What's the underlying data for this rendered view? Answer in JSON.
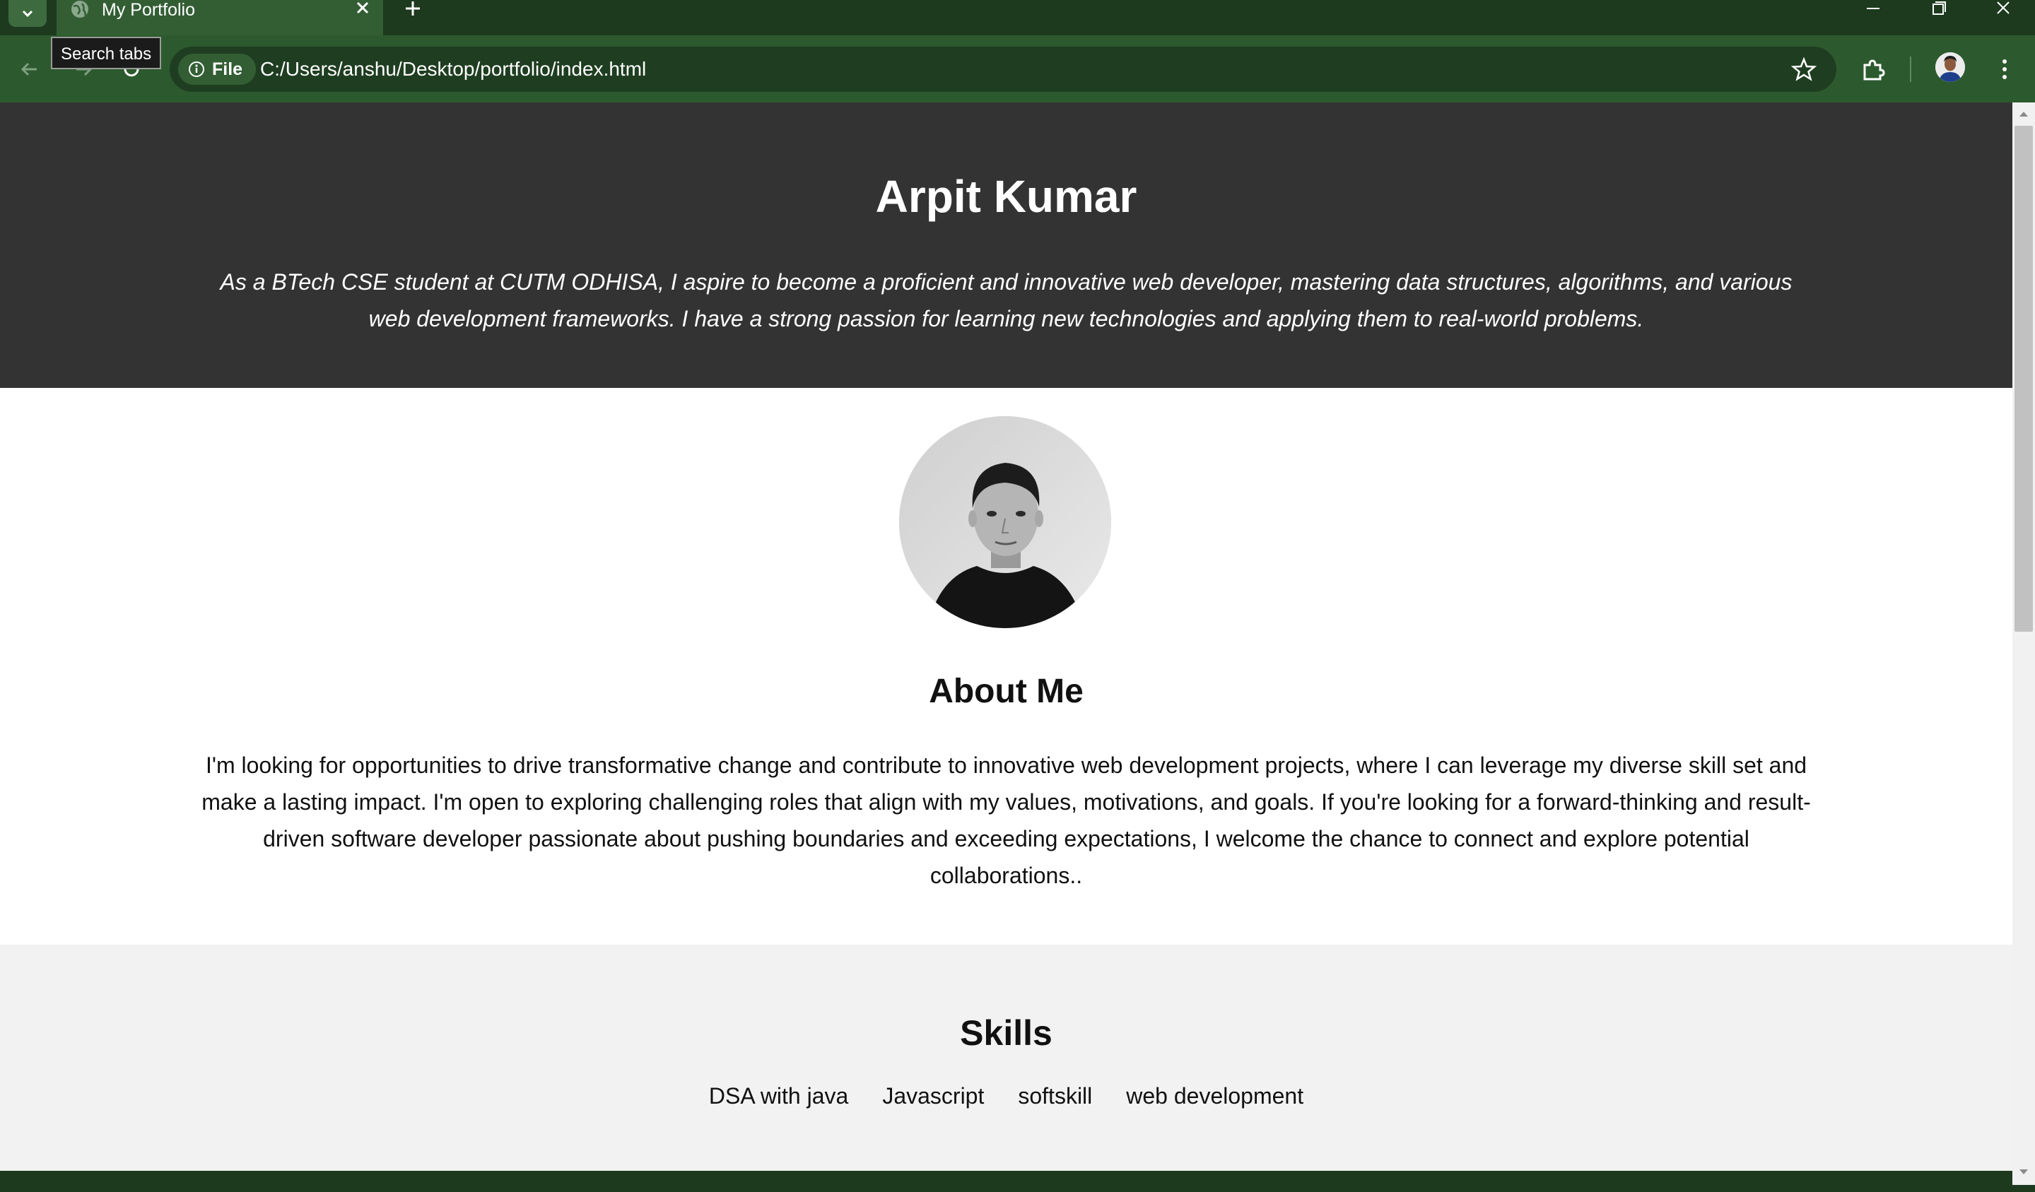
{
  "browser": {
    "tab_title": "My Portfolio",
    "tooltip": "Search tabs",
    "site_chip_label": "File",
    "url": "C:/Users/anshu/Desktop/portfolio/index.html"
  },
  "hero": {
    "name": "Arpit Kumar",
    "tagline": "As a BTech CSE student at CUTM ODHISA, I aspire to become a proficient and innovative web developer, mastering data structures, algorithms, and various web development frameworks. I have a strong passion for learning new technologies and applying them to real-world problems."
  },
  "about": {
    "heading": "About Me",
    "text": "I'm looking for opportunities to drive transformative change and contribute to innovative web development projects, where I can leverage my diverse skill set and make a lasting impact. I'm open to exploring challenging roles that align with my values, motivations, and goals. If you're looking for a forward-thinking and result-driven software developer passionate about pushing boundaries and exceeding expectations, I welcome the chance to connect and explore potential collaborations.."
  },
  "skills": {
    "heading": "Skills",
    "items": [
      "DSA with java",
      "Javascript",
      "softskill",
      "web development"
    ]
  },
  "colors": {
    "chrome_dark": "#1d3a1f",
    "chrome_toolbar": "#2c5a2e",
    "hero_bg": "#333333",
    "skills_bg": "#f2f2f2"
  }
}
